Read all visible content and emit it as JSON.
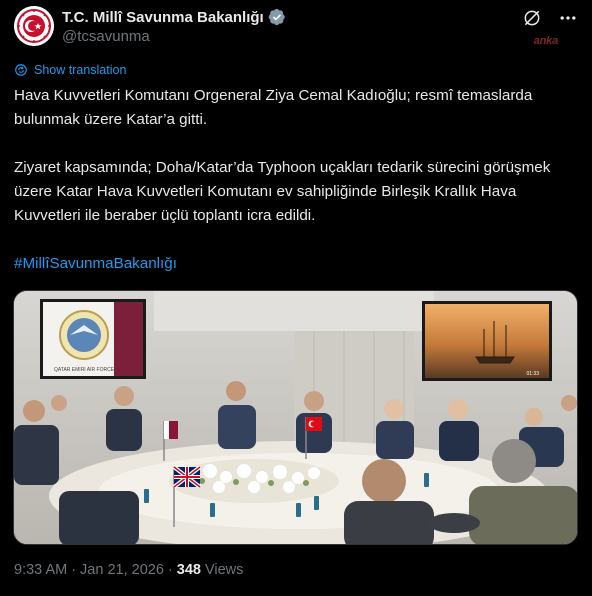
{
  "account": {
    "display_name": "T.C. Millî Savunma Bakanlığı",
    "handle": "@tcsavunma",
    "avatar_icon": "ministry-emblem-icon",
    "verified_icon": "verified-badge-icon"
  },
  "watermark": "anka",
  "translation": {
    "label": "Show translation"
  },
  "post": {
    "paragraph_1": "Hava Kuvvetleri Komutanı Orgeneral Ziya Cemal Kadıoğlu; resmî temaslarda bulunmak üzere Katar’a gitti.",
    "paragraph_2": "Ziyaret kapsamında; Doha/Katar’da Typhoon uçakları tedarik sürecini görüşmek üzere Katar Hava Kuvvetleri Komutanı ev sahipliğinde Birleşik Krallık Hava Kuvvetleri ile beraber üçlü toplantı icra edildi.",
    "hashtag": "#MillîSavunmaBakanlığı"
  },
  "media": {
    "screen_left_caption": "QATAR EMIRI AIR FORCE",
    "screen_right_time": "01:33"
  },
  "meta": {
    "time": "9:33 AM",
    "separator": "·",
    "date": "Jan 21, 2026",
    "views_count": "348",
    "views_label": "Views"
  },
  "colors": {
    "accent": "#1d9bf0",
    "background": "#000000",
    "secondary_text": "#71767b"
  }
}
